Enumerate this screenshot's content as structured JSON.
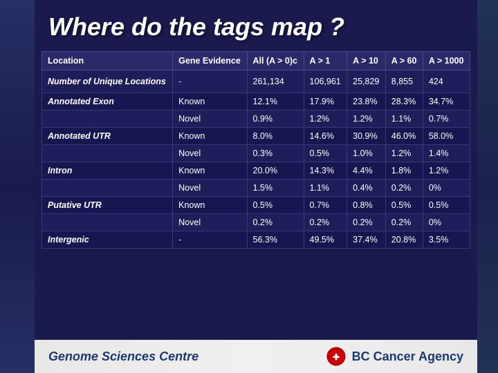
{
  "title": "Where do the tags map ?",
  "table": {
    "headers": [
      "Location",
      "Gene Evidence",
      "All (A > 0)c",
      "A > 1",
      "A > 10",
      "A > 60",
      "A > 1000"
    ],
    "rows": [
      {
        "location": "Number of Unique Locations",
        "gene_evidence": "-",
        "col3": "261,134",
        "col4": "106,961",
        "col5": "25,829",
        "col6": "8,855",
        "col7": "424"
      },
      {
        "location": "Annotated Exon",
        "gene_evidence": "Known",
        "col3": "12.1%",
        "col4": "17.9%",
        "col5": "23.8%",
        "col6": "28.3%",
        "col7": "34.7%"
      },
      {
        "location": "",
        "gene_evidence": "Novel",
        "col3": "0.9%",
        "col4": "1.2%",
        "col5": "1.2%",
        "col6": "1.1%",
        "col7": "0.7%"
      },
      {
        "location": "Annotated UTR",
        "gene_evidence": "Known",
        "col3": "8.0%",
        "col4": "14.6%",
        "col5": "30.9%",
        "col6": "46.0%",
        "col7": "58.0%"
      },
      {
        "location": "",
        "gene_evidence": "Novel",
        "col3": "0.3%",
        "col4": "0.5%",
        "col5": "1.0%",
        "col6": "1.2%",
        "col7": "1.4%"
      },
      {
        "location": "Intron",
        "gene_evidence": "Known",
        "col3": "20.0%",
        "col4": "14.3%",
        "col5": "4.4%",
        "col6": "1.8%",
        "col7": "1.2%"
      },
      {
        "location": "",
        "gene_evidence": "Novel",
        "col3": "1.5%",
        "col4": "1.1%",
        "col5": "0.4%",
        "col6": "0.2%",
        "col7": "0%"
      },
      {
        "location": "Putative UTR",
        "gene_evidence": "Known",
        "col3": "0.5%",
        "col4": "0.7%",
        "col5": "0.8%",
        "col6": "0.5%",
        "col7": "0.5%"
      },
      {
        "location": "",
        "gene_evidence": "Novel",
        "col3": "0.2%",
        "col4": "0.2%",
        "col5": "0.2%",
        "col6": "0.2%",
        "col7": "0%"
      },
      {
        "location": "Intergenic",
        "gene_evidence": "-",
        "col3": "56.3%",
        "col4": "49.5%",
        "col5": "37.4%",
        "col6": "20.8%",
        "col7": "3.5%"
      }
    ]
  },
  "footer": {
    "gsc_label": "Genome Sciences Centre",
    "bc_label": "BC Cancer Agency"
  }
}
